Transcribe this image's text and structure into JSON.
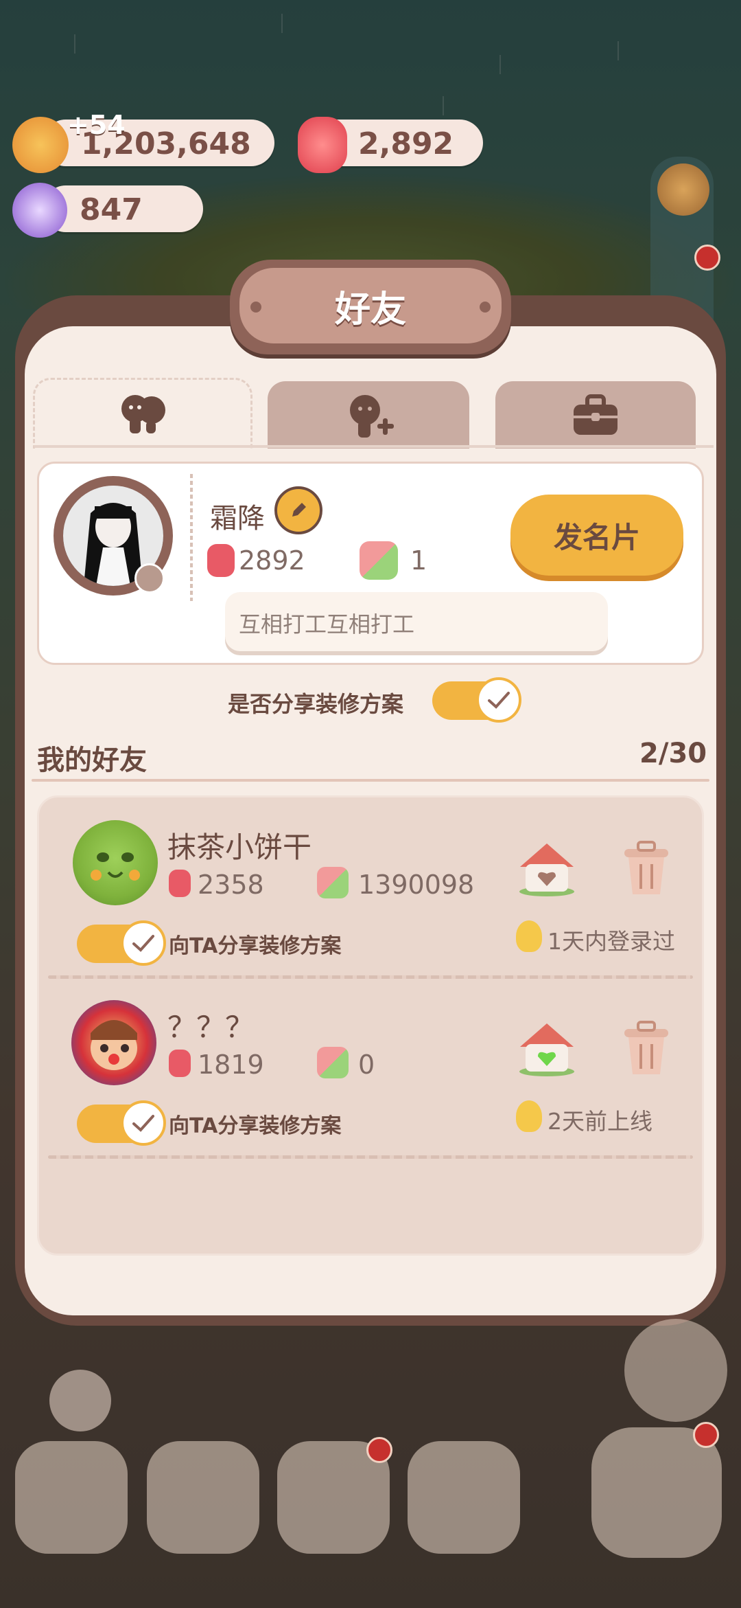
{
  "currency": {
    "cookies": "1,203,648",
    "cookies_bonus": "+54",
    "jelly": "2,892",
    "crystal": "847"
  },
  "panel": {
    "title": "好友",
    "tabs": [
      {
        "icon": "friends-icon",
        "active": true
      },
      {
        "icon": "add-friend-icon",
        "active": false
      },
      {
        "icon": "briefcase-icon",
        "active": false
      }
    ]
  },
  "profile": {
    "name": "霜降",
    "jelly": "2892",
    "likes": "1",
    "card_button": "发名片",
    "motto": "互相打工互相打工"
  },
  "share_setting": {
    "label": "是否分享装修方案",
    "enabled": true
  },
  "friends_section": {
    "title": "我的好友",
    "count": "2/30"
  },
  "friends": [
    {
      "name": "抹茶小饼干",
      "jelly": "2358",
      "likes": "1390098",
      "share_label": "向TA分享装修方案",
      "status": "1天内登录过",
      "house_heart_color": "#a5786a"
    },
    {
      "name": "？？？",
      "jelly": "1819",
      "likes": "0",
      "share_label": "向TA分享装修方案",
      "status": "2天前上线",
      "house_heart_color": "#6fd64a"
    }
  ],
  "colors": {
    "accent": "#f2b441",
    "panel_border": "#6a4a40",
    "text_brown": "#6a4a40"
  }
}
